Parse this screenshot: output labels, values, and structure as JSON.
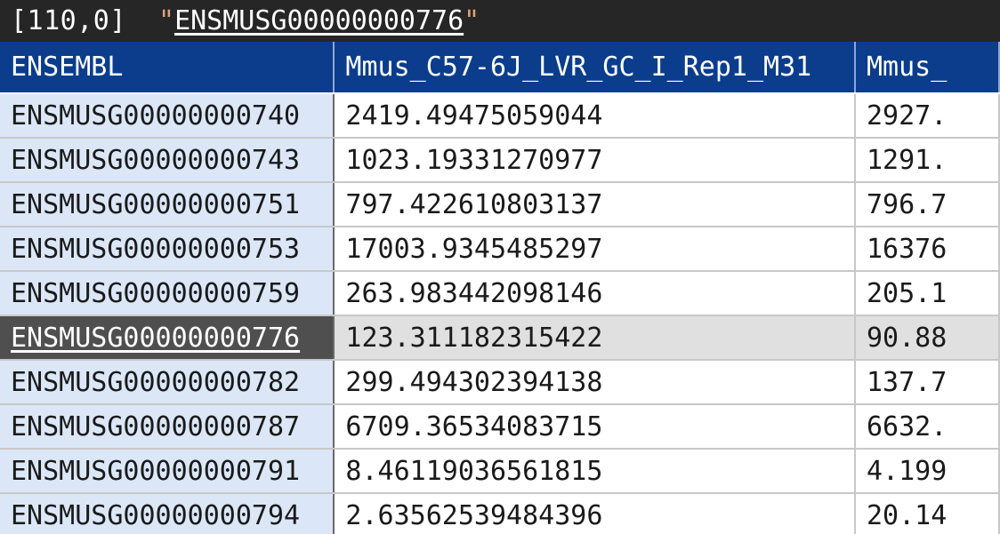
{
  "status": {
    "coord": "[110,0]",
    "quote_open": "\"",
    "value": "ENSMUSG00000000776",
    "quote_close": "\""
  },
  "columns": [
    "ENSEMBL",
    "Mmus_C57-6J_LVR_GC_I_Rep1_M31",
    "Mmus_"
  ],
  "rows": [
    {
      "id": "ENSMUSG00000000740",
      "v1": "2419.49475059044",
      "v2": "2927."
    },
    {
      "id": "ENSMUSG00000000743",
      "v1": "1023.19331270977",
      "v2": "1291."
    },
    {
      "id": "ENSMUSG00000000751",
      "v1": "797.422610803137",
      "v2": "796.7"
    },
    {
      "id": "ENSMUSG00000000753",
      "v1": "17003.9345485297",
      "v2": "16376"
    },
    {
      "id": "ENSMUSG00000000759",
      "v1": "263.983442098146",
      "v2": "205.1"
    },
    {
      "id": "ENSMUSG00000000776",
      "v1": "123.311182315422",
      "v2": "90.88"
    },
    {
      "id": "ENSMUSG00000000782",
      "v1": "299.494302394138",
      "v2": "137.7"
    },
    {
      "id": "ENSMUSG00000000787",
      "v1": "6709.36534083715",
      "v2": "6632."
    },
    {
      "id": "ENSMUSG00000000791",
      "v1": "8.46119036561815",
      "v2": "4.199"
    },
    {
      "id": "ENSMUSG00000000794",
      "v1": "2.63562539484396",
      "v2": "20.14"
    }
  ],
  "selected_row": 5,
  "colors": {
    "header_bg": "#0b3d8c",
    "status_bg": "#262626",
    "key_col_bg": "#dbe7f7",
    "selected_key_bg": "#4f4f4f",
    "selected_row_bg": "#e0e0e0"
  }
}
